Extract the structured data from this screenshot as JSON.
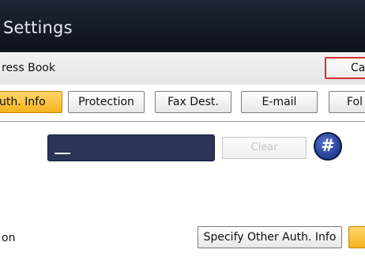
{
  "header": {
    "title": "Settings"
  },
  "section": {
    "label": "ress Book",
    "cancel_label": "Ca"
  },
  "tabs": [
    {
      "label": "uth. Info",
      "active": true
    },
    {
      "label": "Protection",
      "active": false
    },
    {
      "label": "Fax Dest.",
      "active": false
    },
    {
      "label": "E-mail",
      "active": false
    },
    {
      "label": "Fol",
      "active": false
    }
  ],
  "entry": {
    "value": "",
    "clear_label": "Clear",
    "hash_label": "#"
  },
  "bottom": {
    "label": "on",
    "specify_label": "Specify Other Auth. Info"
  },
  "colors": {
    "title_bar": "#141b28",
    "active_tab": "#f5b21e",
    "cancel_border": "#d33131",
    "input_background": "#2a3558",
    "hash_button": "#2d47a0"
  }
}
